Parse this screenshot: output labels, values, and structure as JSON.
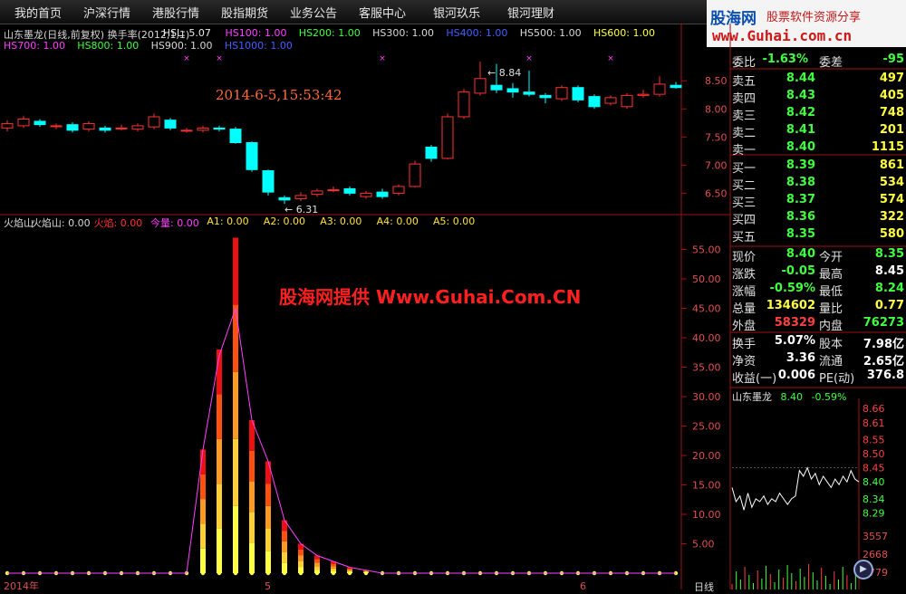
{
  "menu": [
    "我的首页",
    "沪深行情",
    "港股行情",
    "股指期货",
    "业务公告",
    "客服中心",
    "银河玖乐",
    "银河理财"
  ],
  "logo": {
    "brand": "股海网",
    "slogan": "股票软件资源分享",
    "url": "www.Guhai.com.cn"
  },
  "chart_header": {
    "line1": [
      {
        "t": "山东墨龙(日线,前复权) 换手率(2012,1,1)",
        "c": "#d8d8d8"
      },
      {
        "t": "HSL: 5.07",
        "c": "#e8e8e8"
      },
      {
        "t": "HS100: 1.00",
        "c": "#ff40ff"
      },
      {
        "t": "HS200: 1.00",
        "c": "#40ff40"
      },
      {
        "t": "HS300: 1.00",
        "c": "#d8d8d8"
      },
      {
        "t": "HS400: 1.00",
        "c": "#4060ff"
      },
      {
        "t": "HS500: 1.00",
        "c": "#d8d8d8"
      },
      {
        "t": "HS600: 1.00",
        "c": "#ffff40"
      }
    ],
    "line2": [
      {
        "t": "HS700: 1.00",
        "c": "#ff40ff"
      },
      {
        "t": "HS800: 1.00",
        "c": "#40ff40"
      },
      {
        "t": "HS900: 1.00",
        "c": "#d8d8d8"
      },
      {
        "t": "HS1000: 1.00",
        "c": "#4060ff"
      }
    ]
  },
  "chart_data": [
    {
      "type": "candlestick",
      "title": "山东墨龙(日线,前复权)",
      "ylim": [
        6.2,
        9.1
      ],
      "yticks": [
        "8.50",
        "8.00",
        "7.50",
        "7.00",
        "6.50"
      ],
      "annotations": {
        "datetime": "2014-6-5,15:53:42",
        "high_label": "8.84",
        "low_label": "6.31"
      },
      "candles": [
        {
          "o": 7.66,
          "c": 7.74,
          "h": 7.8,
          "l": 7.6
        },
        {
          "o": 7.7,
          "c": 7.82,
          "h": 7.88,
          "l": 7.66
        },
        {
          "o": 7.78,
          "c": 7.72,
          "h": 7.82,
          "l": 7.68
        },
        {
          "o": 7.7,
          "c": 7.7,
          "h": 7.74,
          "l": 7.64
        },
        {
          "o": 7.72,
          "c": 7.62,
          "h": 7.76,
          "l": 7.58
        },
        {
          "o": 7.64,
          "c": 7.74,
          "h": 7.78,
          "l": 7.6
        },
        {
          "o": 7.66,
          "c": 7.62,
          "h": 7.7,
          "l": 7.58
        },
        {
          "o": 7.66,
          "c": 7.66,
          "h": 7.72,
          "l": 7.62
        },
        {
          "o": 7.64,
          "c": 7.7,
          "h": 7.74,
          "l": 7.6
        },
        {
          "o": 7.68,
          "c": 7.86,
          "h": 7.92,
          "l": 7.64
        },
        {
          "o": 7.8,
          "c": 7.66,
          "h": 7.84,
          "l": 7.62
        },
        {
          "o": 7.62,
          "c": 7.62,
          "h": 7.66,
          "l": 7.58
        },
        {
          "o": 7.62,
          "c": 7.66,
          "h": 7.7,
          "l": 7.58
        },
        {
          "o": 7.66,
          "c": 7.64,
          "h": 7.7,
          "l": 7.6
        },
        {
          "o": 7.64,
          "c": 7.4,
          "h": 7.68,
          "l": 7.38
        },
        {
          "o": 7.4,
          "c": 6.92,
          "h": 7.42,
          "l": 6.88
        },
        {
          "o": 6.9,
          "c": 6.52,
          "h": 6.92,
          "l": 6.46
        },
        {
          "o": 6.42,
          "c": 6.38,
          "h": 6.46,
          "l": 6.31
        },
        {
          "o": 6.4,
          "c": 6.46,
          "h": 6.52,
          "l": 6.36
        },
        {
          "o": 6.48,
          "c": 6.54,
          "h": 6.58,
          "l": 6.44
        },
        {
          "o": 6.56,
          "c": 6.56,
          "h": 6.62,
          "l": 6.52
        },
        {
          "o": 6.58,
          "c": 6.5,
          "h": 6.62,
          "l": 6.46
        },
        {
          "o": 6.44,
          "c": 6.5,
          "h": 6.54,
          "l": 6.4
        },
        {
          "o": 6.52,
          "c": 6.44,
          "h": 6.58,
          "l": 6.4
        },
        {
          "o": 6.5,
          "c": 6.62,
          "h": 6.66,
          "l": 6.46
        },
        {
          "o": 6.62,
          "c": 7.02,
          "h": 7.08,
          "l": 6.6
        },
        {
          "o": 7.32,
          "c": 7.12,
          "h": 7.36,
          "l": 7.06
        },
        {
          "o": 7.12,
          "c": 7.86,
          "h": 7.92,
          "l": 7.1
        },
        {
          "o": 7.86,
          "c": 8.3,
          "h": 8.36,
          "l": 7.82
        },
        {
          "o": 8.28,
          "c": 8.54,
          "h": 8.84,
          "l": 8.24
        },
        {
          "o": 8.42,
          "c": 8.34,
          "h": 8.8,
          "l": 8.28
        },
        {
          "o": 8.36,
          "c": 8.3,
          "h": 8.46,
          "l": 8.2
        },
        {
          "o": 8.3,
          "c": 8.26,
          "h": 8.68,
          "l": 8.22
        },
        {
          "o": 8.24,
          "c": 8.2,
          "h": 8.28,
          "l": 8.1
        },
        {
          "o": 8.18,
          "c": 8.38,
          "h": 8.42,
          "l": 8.14
        },
        {
          "o": 8.38,
          "c": 8.16,
          "h": 8.42,
          "l": 8.12
        },
        {
          "o": 8.22,
          "c": 8.04,
          "h": 8.26,
          "l": 8.0
        },
        {
          "o": 8.1,
          "c": 8.2,
          "h": 8.24,
          "l": 8.06
        },
        {
          "o": 8.04,
          "c": 8.24,
          "h": 8.28,
          "l": 8.0
        },
        {
          "o": 8.24,
          "c": 8.26,
          "h": 8.34,
          "l": 8.2
        },
        {
          "o": 8.26,
          "c": 8.44,
          "h": 8.58,
          "l": 8.22
        },
        {
          "o": 8.42,
          "c": 8.38,
          "h": 8.48,
          "l": 8.36
        }
      ]
    },
    {
      "type": "bar",
      "title": "火焰山",
      "ylim": [
        0,
        58
      ],
      "yticks": [
        "55.00",
        "50.00",
        "45.00",
        "40.00",
        "35.00",
        "30.00",
        "25.00",
        "20.00",
        "15.00",
        "10.00",
        "5.00"
      ],
      "values": [
        0,
        0,
        0,
        0,
        0,
        0,
        0,
        0,
        0,
        0,
        0,
        0,
        0,
        0,
        0,
        0,
        0,
        0,
        0,
        0,
        0,
        0,
        0,
        0,
        0,
        0,
        0,
        0,
        0,
        0,
        0,
        0,
        0,
        0,
        0,
        0,
        0,
        0,
        0,
        0,
        0,
        0
      ],
      "flame": [
        0,
        0,
        0,
        0,
        0,
        0,
        0,
        0,
        0,
        0,
        0,
        0,
        21,
        38,
        57,
        26,
        19,
        9,
        5,
        3,
        2,
        1,
        0.5,
        0,
        0,
        0,
        0,
        0,
        0,
        0,
        0,
        0,
        0,
        0,
        0,
        0,
        0,
        0,
        0,
        0,
        0,
        0
      ],
      "line": [
        0,
        0,
        0,
        0,
        0,
        0,
        0,
        0,
        0,
        0,
        0,
        0,
        21,
        37,
        45,
        26,
        19,
        9,
        5,
        3,
        2,
        1,
        0.5,
        0,
        0,
        0,
        0,
        0,
        0,
        0,
        0,
        0,
        0,
        0,
        0,
        0,
        0,
        0,
        0,
        0,
        0,
        0
      ],
      "header": [
        {
          "t": "火焰山",
          "c": "#d8d8d8"
        },
        {
          "t": "火焰山: 0.00",
          "c": "#d8d8d8"
        },
        {
          "t": "火焰: 0.00",
          "c": "#ff3030"
        },
        {
          "t": "今量: 0.00",
          "c": "#ff40ff"
        },
        {
          "t": "A1: 0.00",
          "c": "#ffe040"
        },
        {
          "t": "A2: 0.00",
          "c": "#ffe040"
        },
        {
          "t": "A3: 0.00",
          "c": "#ffe040"
        },
        {
          "t": "A4: 0.00",
          "c": "#ffe040"
        },
        {
          "t": "A5: 0.00",
          "c": "#ffe040"
        }
      ],
      "xlabels": [
        "2014年",
        "5",
        "6"
      ]
    },
    {
      "type": "line",
      "title": "山东墨龙",
      "last": "8.40",
      "change": "-0.59%",
      "yticks": [
        "8.66",
        "8.61",
        "8.55",
        "8.50",
        "8.45",
        "8.40",
        "8.34",
        "8.29"
      ],
      "vol_ticks": [
        "3557",
        "2668",
        "1779"
      ],
      "ylim": [
        8.24,
        8.68
      ],
      "values": [
        8.38,
        8.33,
        8.35,
        8.3,
        8.36,
        8.31,
        8.34,
        8.33,
        8.35,
        8.32,
        8.34,
        8.33,
        8.36,
        8.34,
        8.32,
        8.34,
        8.35,
        8.44,
        8.42,
        8.45,
        8.41,
        8.43,
        8.39,
        8.42,
        8.4,
        8.38,
        8.41,
        8.39,
        8.42,
        8.4,
        8.44,
        8.41,
        8.4
      ]
    }
  ],
  "watermark": "股海网提供  Www.Guhai.Com.CN",
  "bottom_tab": "日线",
  "quote": {
    "weibi": {
      "label": "委比",
      "value": "-1.63%",
      "label2": "委差",
      "value2": "-95"
    },
    "asks": [
      {
        "label": "卖五",
        "price": "8.44",
        "vol": "497"
      },
      {
        "label": "卖四",
        "price": "8.43",
        "vol": "405"
      },
      {
        "label": "卖三",
        "price": "8.42",
        "vol": "748"
      },
      {
        "label": "卖二",
        "price": "8.41",
        "vol": "201"
      },
      {
        "label": "卖一",
        "price": "8.40",
        "vol": "1115"
      }
    ],
    "bids": [
      {
        "label": "买一",
        "price": "8.39",
        "vol": "861"
      },
      {
        "label": "买二",
        "price": "8.38",
        "vol": "534"
      },
      {
        "label": "买三",
        "price": "8.37",
        "vol": "574"
      },
      {
        "label": "买四",
        "price": "8.36",
        "vol": "322"
      },
      {
        "label": "买五",
        "price": "8.35",
        "vol": "580"
      }
    ],
    "stats1": [
      {
        "l1": "现价",
        "v1": "8.40",
        "c1": "#40ff40",
        "l2": "今开",
        "v2": "8.35",
        "c2": "#40ff40"
      },
      {
        "l1": "涨跌",
        "v1": "-0.05",
        "c1": "#40ff40",
        "l2": "最高",
        "v2": "8.45",
        "c2": "#ffffff"
      },
      {
        "l1": "涨幅",
        "v1": "-0.59%",
        "c1": "#40ff40",
        "l2": "最低",
        "v2": "8.24",
        "c2": "#40ff40"
      },
      {
        "l1": "总量",
        "v1": "134602",
        "c1": "#ffff40",
        "l2": "量比",
        "v2": "0.77",
        "c2": "#ffff40"
      },
      {
        "l1": "外盘",
        "v1": "58329",
        "c1": "#ff4040",
        "l2": "内盘",
        "v2": "76273",
        "c2": "#40ff40"
      }
    ],
    "stats2": [
      {
        "l1": "换手",
        "v1": "5.07%",
        "c1": "#ffffff",
        "l2": "股本",
        "v2": "7.98亿",
        "c2": "#ffffff"
      },
      {
        "l1": "净资",
        "v1": "3.36",
        "c1": "#ffffff",
        "l2": "流通",
        "v2": "2.65亿",
        "c2": "#ffffff"
      },
      {
        "l1": "收益(一)",
        "v1": "0.006",
        "c1": "#ffffff",
        "l2": "PE(动)",
        "v2": "376.8",
        "c2": "#ffffff"
      }
    ]
  }
}
